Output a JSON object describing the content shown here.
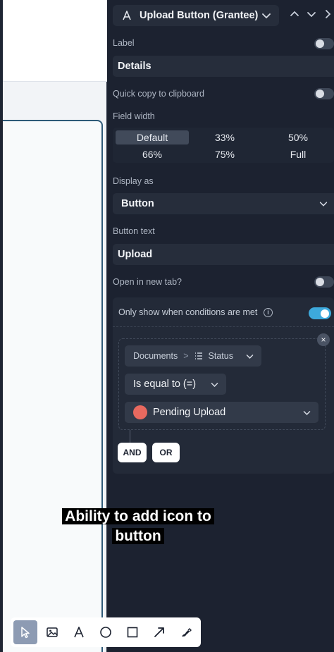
{
  "header": {
    "field_select_title": "Upload Button (Grantee)"
  },
  "label_section": {
    "label": "Label",
    "value": "Details",
    "toggle_on": false
  },
  "quick_copy": {
    "label": "Quick copy to clipboard",
    "toggle_on": false
  },
  "field_width": {
    "label": "Field width",
    "options": [
      "Default",
      "33%",
      "50%",
      "66%",
      "75%",
      "Full"
    ],
    "selected": "Default"
  },
  "display_as": {
    "label": "Display as",
    "value": "Button"
  },
  "button_text": {
    "label": "Button text",
    "value": "Upload"
  },
  "open_new_tab": {
    "label": "Open in new tab?",
    "toggle_on": false
  },
  "conditions": {
    "label": "Only show when conditions are met",
    "info_icon": "i",
    "toggle_on": true,
    "rule": {
      "source": "Documents",
      "separator": ">",
      "field": "Status",
      "operator": "Is equal to (=)",
      "value": "Pending Upload",
      "value_color": "#e8695f"
    },
    "close": "×",
    "and_label": "AND",
    "or_label": "OR"
  },
  "caption": {
    "line1": "Ability to add icon to",
    "line2": "button"
  },
  "toolbar": {
    "tools": [
      "pointer-icon",
      "image-icon",
      "text-icon",
      "ellipse-icon",
      "rectangle-icon",
      "arrow-icon",
      "pen-icon"
    ],
    "active": "pointer-icon"
  },
  "colors": {
    "panel_bg": "#1c2230",
    "toggle_on": "#3da9dc",
    "canvas_border": "#2e5a78"
  }
}
